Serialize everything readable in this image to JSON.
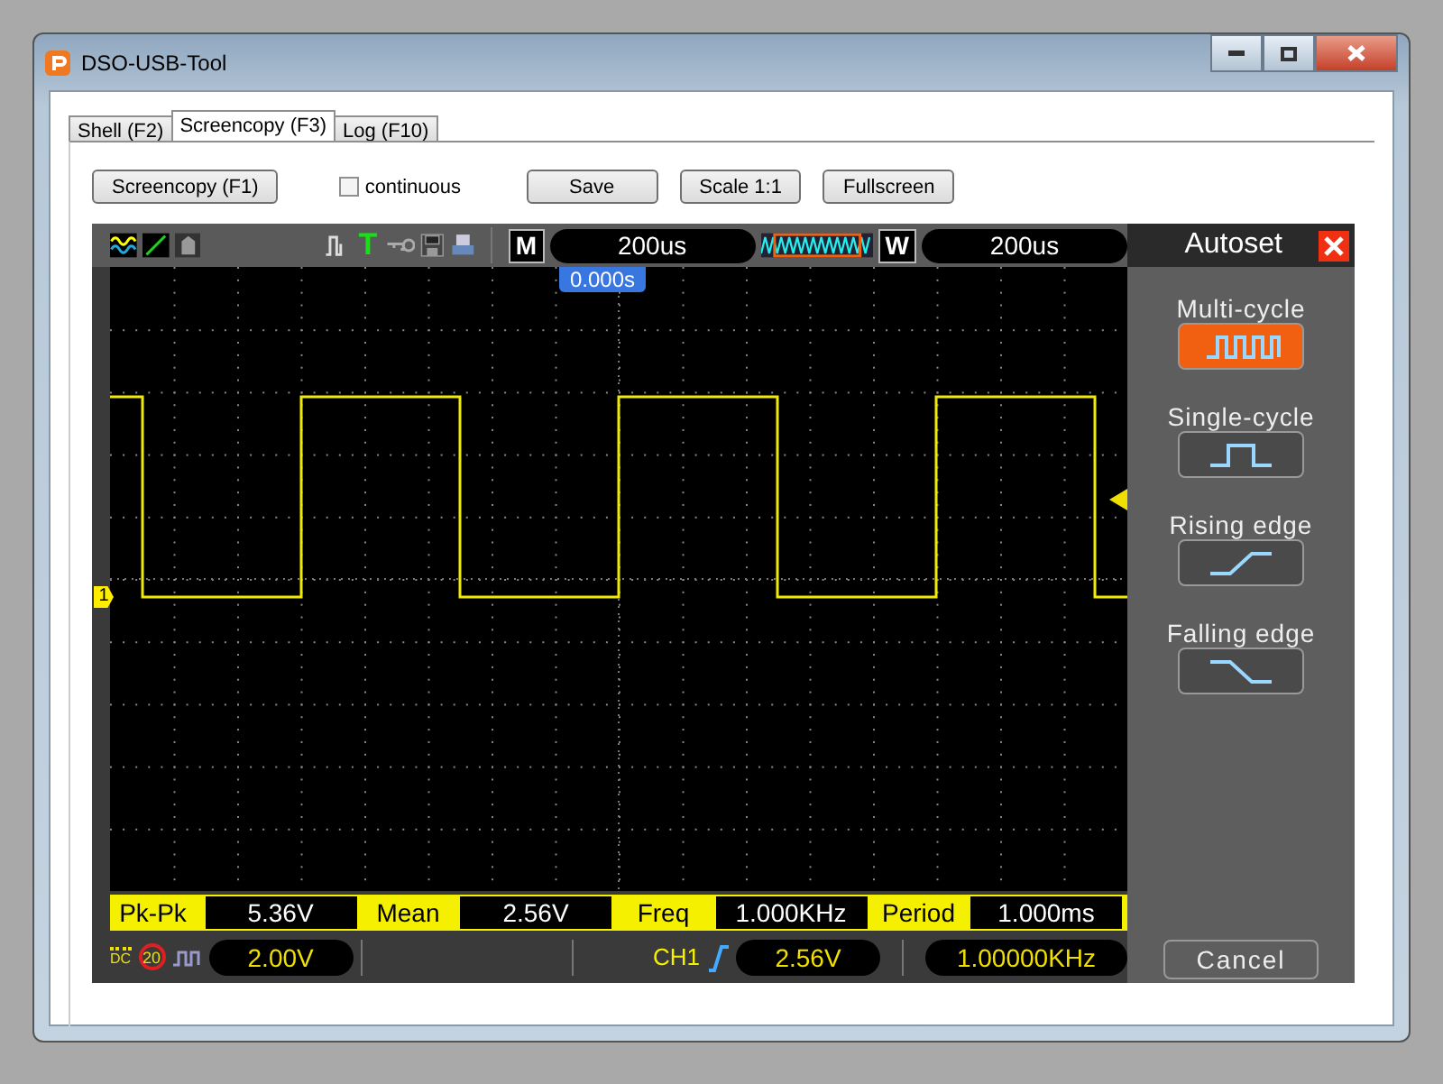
{
  "window": {
    "title": "DSO-USB-Tool"
  },
  "tabs": [
    {
      "label": "Shell (F2)",
      "selected": false
    },
    {
      "label": "Screencopy (F3)",
      "selected": true
    },
    {
      "label": "Log (F10)",
      "selected": false
    }
  ],
  "toolbar": {
    "screencopy_button": "Screencopy (F1)",
    "checkbox": {
      "label": "continuous",
      "checked": false
    },
    "buttons": [
      "Save",
      "Scale 1:1",
      "Fullscreen"
    ]
  },
  "scope": {
    "trigger_label": "T",
    "m_label": "M",
    "timebase": "200us",
    "w_label": "W",
    "window_timebase": "200us",
    "trigger_position": "0.000s",
    "channel_marker": "1",
    "measurements": [
      {
        "label": "Pk-Pk",
        "value": "5.36V"
      },
      {
        "label": "Mean",
        "value": "2.56V"
      },
      {
        "label": "Freq",
        "value": "1.000KHz"
      },
      {
        "label": "Period",
        "value": "1.000ms"
      }
    ],
    "status": {
      "coupling": "DC",
      "bandwidth_limit": "20",
      "volts_per_div": "2.00V",
      "trigger_source": "CH1",
      "trigger_level": "2.56V",
      "frequency": "1.00000KHz"
    }
  },
  "autoset": {
    "title": "Autoset",
    "options": [
      {
        "label": "Multi-cycle",
        "kind": "multi",
        "selected": true
      },
      {
        "label": "Single-cycle",
        "kind": "single",
        "selected": false
      },
      {
        "label": "Rising edge",
        "kind": "rising",
        "selected": false
      },
      {
        "label": "Falling edge",
        "kind": "falling",
        "selected": false
      }
    ],
    "cancel": "Cancel"
  }
}
